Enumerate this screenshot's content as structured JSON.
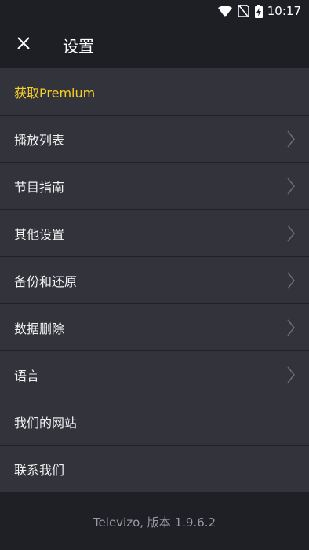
{
  "status_bar": {
    "time": "10:17",
    "icons": [
      "wifi-icon",
      "no-sim-icon",
      "battery-charging-icon"
    ]
  },
  "app_bar": {
    "close_icon": "close-icon",
    "title": "设置"
  },
  "menu": {
    "items": [
      {
        "label": "获取Premium",
        "has_chevron": false,
        "highlight": true
      },
      {
        "label": "播放列表",
        "has_chevron": true
      },
      {
        "label": "节目指南",
        "has_chevron": true
      },
      {
        "label": "其他设置",
        "has_chevron": true
      },
      {
        "label": "备份和还原",
        "has_chevron": true
      },
      {
        "label": "数据删除",
        "has_chevron": true
      },
      {
        "label": "语言",
        "has_chevron": true
      },
      {
        "label": "我们的网站",
        "has_chevron": false
      },
      {
        "label": "联系我们",
        "has_chevron": false
      }
    ]
  },
  "footer": {
    "version_text": "Televizo, 版本 1.9.6.2"
  },
  "colors": {
    "background": "#1f1f26",
    "menu_bg": "#33333c",
    "premium_accent": "#f5d026",
    "footer_text": "#9a9aa2"
  }
}
